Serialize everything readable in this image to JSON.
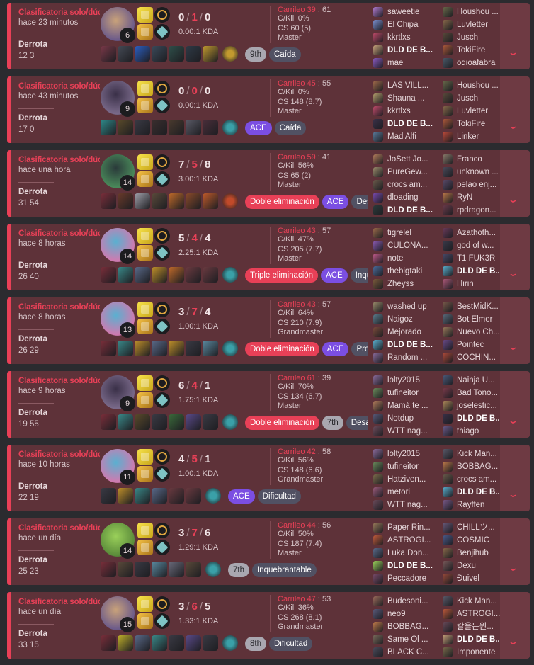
{
  "ui": {
    "expand_glyph": "⌄"
  },
  "matches": [
    {
      "queue": "Clasificatoria solo/dúo",
      "ago": "hace 23 minutos",
      "result": "Derrota",
      "duration": "12 3",
      "level": "6",
      "kills": "0",
      "deaths": "1",
      "assists": "0",
      "ratio": "0.00:1 KDA",
      "pkill": "Carrileo 39",
      "pkill_rest": "61",
      "ckill": "C/Kill 0%",
      "cs": "CS 60 (5)",
      "rank": "Master",
      "champ_colors": [
        "#c9a27a",
        "#6b5a8a"
      ],
      "items": [
        "#7a3848",
        "#444a55",
        "#2b5fc4",
        "#3a4a5a",
        "#2e4f4a",
        "#2e3a46",
        "#c29a2f"
      ],
      "trinket": "#c29a2f",
      "tags": [
        {
          "text": "9th",
          "style": "light"
        },
        {
          "text": "Caída",
          "style": "gray"
        }
      ],
      "team1": [
        {
          "name": "saweetie",
          "c": "#b07ad0"
        },
        {
          "name": "El Chipa",
          "c": "#7a8fd0"
        },
        {
          "name": "kkrtlxs",
          "c": "#c04a6a"
        },
        {
          "name": "DLD DE B...",
          "c": "#c9a27a",
          "me": true
        },
        {
          "name": "mae",
          "c": "#8a5ac0"
        }
      ],
      "team2": [
        {
          "name": "Houshou ...",
          "c": "#6a6a4a"
        },
        {
          "name": "Luvletter",
          "c": "#8a6a4a"
        },
        {
          "name": "Jusch",
          "c": "#5a4a3a"
        },
        {
          "name": "TokiFire",
          "c": "#b05a3a"
        },
        {
          "name": "odioafabra",
          "c": "#4a5a6a"
        }
      ]
    },
    {
      "queue": "Clasificatoria solo/dúo",
      "ago": "hace 43 minutos",
      "result": "Derrota",
      "duration": "17 0",
      "level": "9",
      "kills": "0",
      "deaths": "0",
      "assists": "0",
      "ratio": "0.00:1 KDA",
      "pkill": "Carrileo 45",
      "pkill_rest": "55",
      "ckill": "C/Kill 0%",
      "cs": "CS 148 (8.7)",
      "rank": "Master",
      "champ_colors": [
        "#3a3048",
        "#7a6a8a"
      ],
      "items": [
        "#2e8a8a",
        "#5a4a2a",
        "#3a3a44",
        "#3a2e2e",
        "#4a3a2e",
        "#5a5a66",
        "#4a2e3a"
      ],
      "trinket": "#3aa0a8",
      "tags": [
        {
          "text": "ACE",
          "style": "purple"
        },
        {
          "text": "Caída",
          "style": "gray"
        }
      ],
      "team1": [
        {
          "name": "LAS VILL...",
          "c": "#a06a4a"
        },
        {
          "name": "Shauna ...",
          "c": "#b09a6a"
        },
        {
          "name": "kkrtlxs",
          "c": "#c04a6a"
        },
        {
          "name": "DLD DE B...",
          "c": "#3a3048",
          "me": true
        },
        {
          "name": "Mad Alfi",
          "c": "#5a7a9a"
        }
      ],
      "team2": [
        {
          "name": "Houshou ...",
          "c": "#6a6a4a"
        },
        {
          "name": "Jusch",
          "c": "#5a4a3a"
        },
        {
          "name": "Luvletter",
          "c": "#8a6a4a"
        },
        {
          "name": "TokiFire",
          "c": "#b05a3a"
        },
        {
          "name": "Linker",
          "c": "#c04a3a"
        }
      ]
    },
    {
      "queue": "Clasificatoria solo/dúo",
      "ago": "hace una hora",
      "result": "Derrota",
      "duration": "31 54",
      "level": "14",
      "kills": "7",
      "deaths": "5",
      "assists": "8",
      "ratio": "3.00:1 KDA",
      "pkill": "Carrileo 59",
      "pkill_rest": "41",
      "ckill": "C/Kill 56%",
      "cs": "CS 65 (2)",
      "rank": "Master",
      "champ_colors": [
        "#2a3a3a",
        "#4a8a5a"
      ],
      "items": [
        "#7a2e3a",
        "#6a3a2a",
        "#a0a0aa",
        "#5a4a3a",
        "#c06a2a",
        "#8a4a2a",
        "#c05a2a"
      ],
      "trinket": "#c04a2a",
      "tags": [
        {
          "text": "Doble eliminación",
          "style": "red"
        },
        {
          "text": "ACE",
          "style": "purple"
        },
        {
          "text": "Desafor",
          "style": "gray"
        }
      ],
      "team1": [
        {
          "name": "JoSett Jo...",
          "c": "#b07a5a"
        },
        {
          "name": "PureGew...",
          "c": "#9a8a6a"
        },
        {
          "name": "crocs am...",
          "c": "#6a5a4a"
        },
        {
          "name": "dloading",
          "c": "#7a4ab0"
        },
        {
          "name": "DLD DE B...",
          "c": "#2a3a3a",
          "me": true
        }
      ],
      "team2": [
        {
          "name": "Franco",
          "c": "#8a7a6a"
        },
        {
          "name": "unknown ...",
          "c": "#4a4a5a"
        },
        {
          "name": "pelao enj...",
          "c": "#5a4a6a"
        },
        {
          "name": "RyN",
          "c": "#c07a4a"
        },
        {
          "name": "rpdragon...",
          "c": "#6a3a4a"
        }
      ]
    },
    {
      "queue": "Clasificatoria solo/dúo",
      "ago": "hace 8 horas",
      "result": "Derrota",
      "duration": "26 40",
      "level": "14",
      "kills": "5",
      "deaths": "4",
      "assists": "4",
      "ratio": "2.25:1 KDA",
      "pkill": "Carrileo 43",
      "pkill_rest": "57",
      "ckill": "C/Kill 47%",
      "cs": "CS 205 (7.7)",
      "rank": "Master",
      "champ_colors": [
        "#5ab0d0",
        "#d07ab0"
      ],
      "items": [
        "#7a2e3a",
        "#3a8a8a",
        "#5a6a8a",
        "#c0902a",
        "#c06a2a",
        "#6a3a40",
        "#6a3a40"
      ],
      "trinket": "#3aa0a8",
      "tags": [
        {
          "text": "Triple eliminación",
          "style": "red"
        },
        {
          "text": "ACE",
          "style": "purple"
        },
        {
          "text": "Inqueb",
          "style": "gray"
        }
      ],
      "team1": [
        {
          "name": "tigrelel",
          "c": "#9a6a4a"
        },
        {
          "name": "CULONA...",
          "c": "#8a5ab0"
        },
        {
          "name": "note",
          "c": "#c05a8a"
        },
        {
          "name": "thebigtaki",
          "c": "#4a6a9a"
        },
        {
          "name": "Zheyss",
          "c": "#7a5a3a"
        }
      ],
      "team2": [
        {
          "name": "Azathoth...",
          "c": "#6a3a5a"
        },
        {
          "name": "god of w...",
          "c": "#3a3a4a"
        },
        {
          "name": "T1 FUK3R",
          "c": "#4a4a6a"
        },
        {
          "name": "DLD DE B...",
          "c": "#5ab0d0",
          "me": true
        },
        {
          "name": "Hirin",
          "c": "#b05a7a"
        }
      ]
    },
    {
      "queue": "Clasificatoria solo/dúo",
      "ago": "hace 8 horas",
      "result": "Derrota",
      "duration": "26 29",
      "level": "13",
      "kills": "3",
      "deaths": "7",
      "assists": "4",
      "ratio": "1.00:1 KDA",
      "pkill": "Carrileo 43",
      "pkill_rest": "57",
      "ckill": "C/Kill 64%",
      "cs": "CS 210 (7.9)",
      "rank": "Grandmaster",
      "champ_colors": [
        "#5ab0d0",
        "#d07ab0"
      ],
      "items": [
        "#7a2e3a",
        "#3a8a8a",
        "#c0902a",
        "#5a6a8a",
        "#c0902a",
        "#3a3a44",
        "#5a8aa0"
      ],
      "trinket": "#3aa0a8",
      "tags": [
        {
          "text": "Doble eliminación",
          "style": "red"
        },
        {
          "text": "ACE",
          "style": "purple"
        },
        {
          "text": "Prome",
          "style": "gray"
        }
      ],
      "team1": [
        {
          "name": "washed up",
          "c": "#9a8a6a"
        },
        {
          "name": "Naigoz",
          "c": "#5a7a8a"
        },
        {
          "name": "Mejorado",
          "c": "#7a4a3a"
        },
        {
          "name": "DLD DE B...",
          "c": "#5ab0d0",
          "me": true
        },
        {
          "name": "Random ...",
          "c": "#8a6a9a"
        }
      ],
      "team2": [
        {
          "name": "BestMidK...",
          "c": "#7a5a4a"
        },
        {
          "name": "Bot Elmer",
          "c": "#5a6a7a"
        },
        {
          "name": "Nuevo Ch...",
          "c": "#9a7a5a"
        },
        {
          "name": "Pointec",
          "c": "#6a4a8a"
        },
        {
          "name": "COCHIN...",
          "c": "#b04a3a"
        }
      ]
    },
    {
      "queue": "Clasificatoria solo/dúo",
      "ago": "hace 9 horas",
      "result": "Derrota",
      "duration": "19 55",
      "level": "9",
      "kills": "6",
      "deaths": "4",
      "assists": "1",
      "ratio": "1.75:1 KDA",
      "pkill": "Carrileo 61",
      "pkill_rest": "39",
      "ckill": "C/Kill 70%",
      "cs": "CS 134 (6.7)",
      "rank": "Master",
      "champ_colors": [
        "#3a3048",
        "#7a6a8a"
      ],
      "items": [
        "#7a2e3a",
        "#3a8a8a",
        "#5a4a2a",
        "#3a3a44",
        "#3a6a3a",
        "#5a4a8a",
        "#3a3a44"
      ],
      "trinket": "#3aa0a8",
      "tags": [
        {
          "text": "Doble eliminación",
          "style": "red"
        },
        {
          "text": "7th",
          "style": "light"
        },
        {
          "text": "Desafor",
          "style": "gray"
        }
      ],
      "team1": [
        {
          "name": "lolty2015",
          "c": "#8a6a9a"
        },
        {
          "name": "tufineitor",
          "c": "#6a8a5a"
        },
        {
          "name": "Mamá te ...",
          "c": "#b07a5a"
        },
        {
          "name": "Notdup",
          "c": "#5a5a7a"
        },
        {
          "name": "WTT nag...",
          "c": "#6a4a5a"
        }
      ],
      "team2": [
        {
          "name": "Nainja U...",
          "c": "#4a5a7a"
        },
        {
          "name": "Bad Tono...",
          "c": "#7a3a4a"
        },
        {
          "name": "joselestic...",
          "c": "#b08a5a"
        },
        {
          "name": "DLD DE B...",
          "c": "#3a3048",
          "me": true
        },
        {
          "name": "thiago",
          "c": "#6a5a8a"
        }
      ]
    },
    {
      "queue": "Clasificatoria solo/dúo",
      "ago": "hace 10 horas",
      "result": "Derrota",
      "duration": "22 19",
      "level": "11",
      "kills": "4",
      "deaths": "5",
      "assists": "1",
      "ratio": "1.00:1 KDA",
      "pkill": "Carrileo 42",
      "pkill_rest": "58",
      "ckill": "C/Kill 56%",
      "cs": "CS 148 (6.6)",
      "rank": "Grandmaster",
      "champ_colors": [
        "#5ab0d0",
        "#d07ab0"
      ],
      "items": [
        "#3a3a44",
        "#c0902a",
        "#3a8a8a",
        "#5a6a8a",
        "#6a3a40",
        "#6a3a40"
      ],
      "trinket": "#3aa0a8",
      "tags": [
        {
          "text": "ACE",
          "style": "purple"
        },
        {
          "text": "Dificultad",
          "style": "gray"
        }
      ],
      "team1": [
        {
          "name": "lolty2015",
          "c": "#8a6a9a"
        },
        {
          "name": "tufineitor",
          "c": "#6a8a5a"
        },
        {
          "name": "Hatziven...",
          "c": "#7a6a4a"
        },
        {
          "name": "metori",
          "c": "#9a5a7a"
        },
        {
          "name": "WTT nag...",
          "c": "#6a4a5a"
        }
      ],
      "team2": [
        {
          "name": "Kick Man...",
          "c": "#5a5a6a"
        },
        {
          "name": "BOBBAG...",
          "c": "#c07a4a"
        },
        {
          "name": "crocs am...",
          "c": "#6a5a4a"
        },
        {
          "name": "DLD DE B...",
          "c": "#5ab0d0",
          "me": true
        },
        {
          "name": "Rayffen",
          "c": "#7a5a8a"
        }
      ]
    },
    {
      "queue": "Clasificatoria solo/dúo",
      "ago": "hace un día",
      "result": "Derrota",
      "duration": "25 23",
      "level": "14",
      "kills": "3",
      "deaths": "7",
      "assists": "6",
      "ratio": "1.29:1 KDA",
      "pkill": "Carrileo 44",
      "pkill_rest": "56",
      "ckill": "C/Kill 50%",
      "cs": "CS 187 (7.4)",
      "rank": "Master",
      "champ_colors": [
        "#9ad05a",
        "#5a8a3a"
      ],
      "items": [
        "#7a2e3a",
        "#5a4a3a",
        "#3a3a44",
        "#5a8aa0",
        "#6a6a7a",
        "#5a4a3a"
      ],
      "trinket": "#3aa0a8",
      "tags": [
        {
          "text": "7th",
          "style": "light"
        },
        {
          "text": "Inquebrantable",
          "style": "gray"
        }
      ],
      "team1": [
        {
          "name": "Paper Rin...",
          "c": "#9a7a5a"
        },
        {
          "name": "ASTROGI...",
          "c": "#c05a3a"
        },
        {
          "name": "Luka Don...",
          "c": "#5a6a8a"
        },
        {
          "name": "DLD DE B...",
          "c": "#9ad05a",
          "me": true
        },
        {
          "name": "Peccadore",
          "c": "#7a4a6a"
        }
      ],
      "team2": [
        {
          "name": "CHILLツ...",
          "c": "#6a5a7a"
        },
        {
          "name": "COSMIC",
          "c": "#4a5a8a"
        },
        {
          "name": "Benjihub",
          "c": "#8a6a4a"
        },
        {
          "name": "Dexu",
          "c": "#7a5a5a"
        },
        {
          "name": "Đuivel",
          "c": "#9a4a3a"
        }
      ]
    },
    {
      "queue": "Clasificatoria solo/dúo",
      "ago": "hace un día",
      "result": "Derrota",
      "duration": "33 15",
      "level": "15",
      "kills": "3",
      "deaths": "6",
      "assists": "5",
      "ratio": "1.33:1 KDA",
      "pkill": "Carrileo 47",
      "pkill_rest": "53",
      "ckill": "C/Kill 36%",
      "cs": "CS 268 (8.1)",
      "rank": "Grandmaster",
      "champ_colors": [
        "#c9a27a",
        "#6b5a8a"
      ],
      "items": [
        "#7a2e3a",
        "#c0b02a",
        "#5a6a8a",
        "#3a8a8a",
        "#3a3a44",
        "#5a4a8a",
        "#3a3a44"
      ],
      "trinket": "#3aa0a8",
      "tags": [
        {
          "text": "8th",
          "style": "light"
        },
        {
          "text": "Dificultad",
          "style": "gray"
        }
      ],
      "team1": [
        {
          "name": "Budesoni...",
          "c": "#9a6a5a"
        },
        {
          "name": "neo9",
          "c": "#5a5a7a"
        },
        {
          "name": "BOBBAG...",
          "c": "#c07a4a"
        },
        {
          "name": "Same Ol ...",
          "c": "#7a6a5a"
        },
        {
          "name": "BLACK C...",
          "c": "#4a4a5a"
        }
      ],
      "team2": [
        {
          "name": "Kick Man...",
          "c": "#5a5a6a"
        },
        {
          "name": "ASTROGI...",
          "c": "#c05a3a"
        },
        {
          "name": "칼을든원...",
          "c": "#6a4a5a"
        },
        {
          "name": "DLD DE B...",
          "c": "#c9a27a",
          "me": true
        },
        {
          "name": "Imponente",
          "c": "#7a6a4a"
        }
      ]
    }
  ]
}
